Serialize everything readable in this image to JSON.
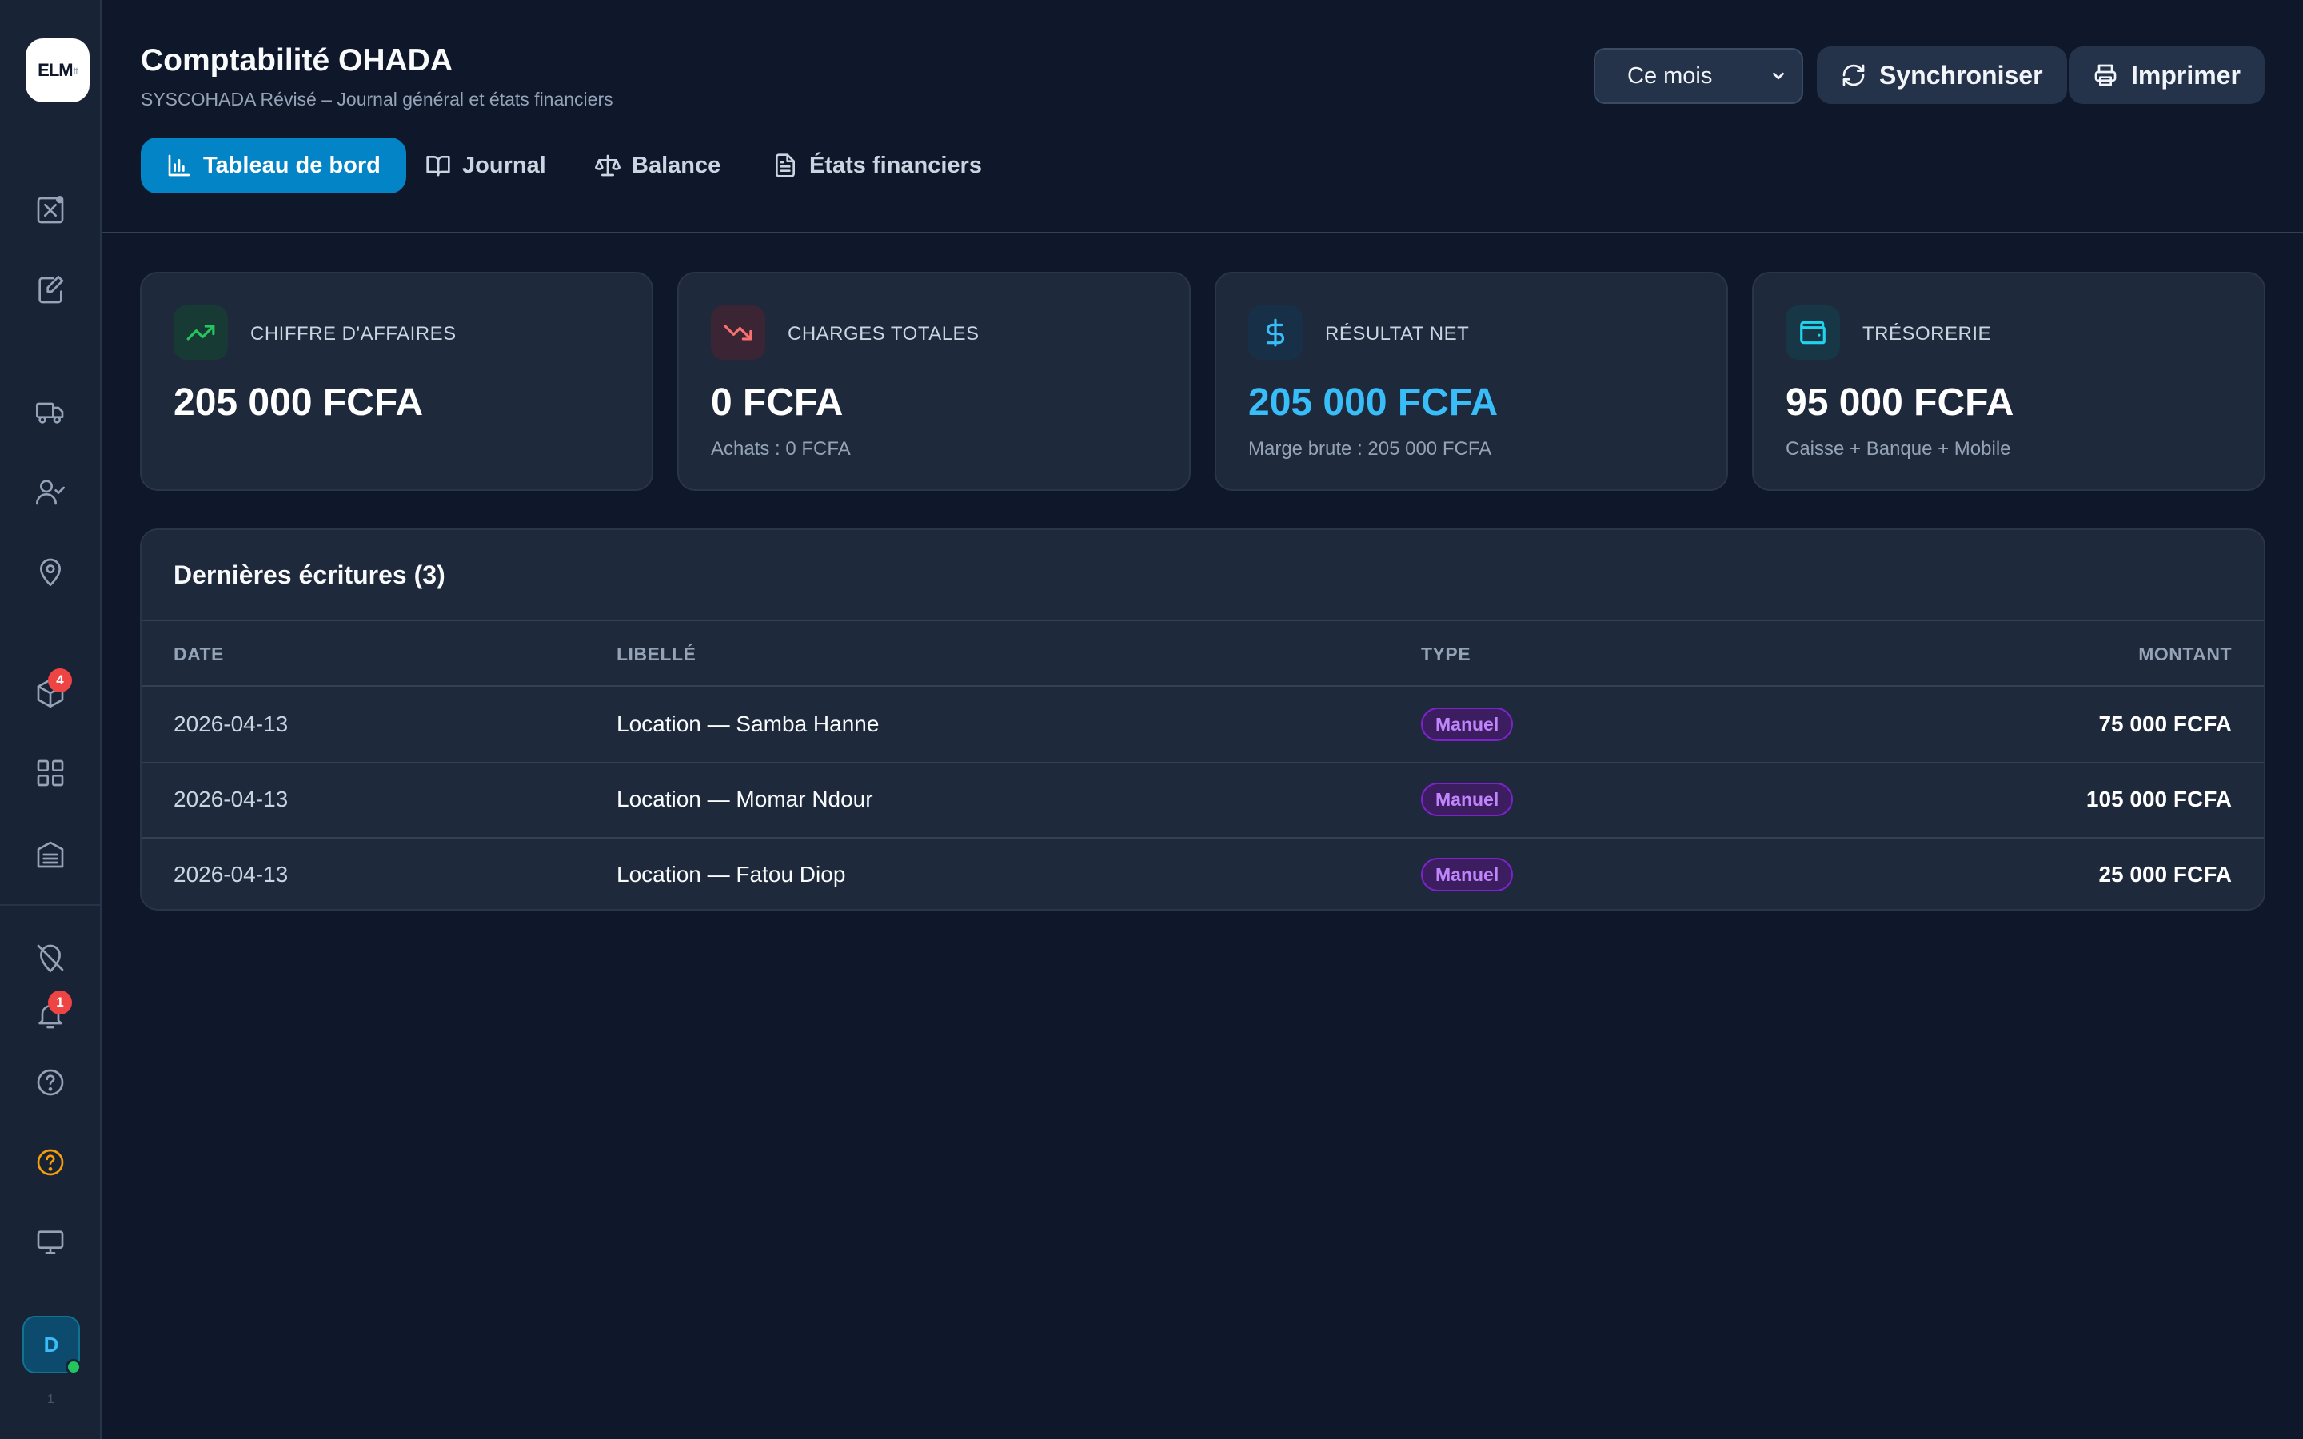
{
  "sidebar": {
    "logo_text": "ELM",
    "logo_sub": "tt",
    "items": [
      {
        "icon": "spreadsheet-x-icon"
      },
      {
        "icon": "edit-document-icon"
      },
      {
        "icon": "truck-icon"
      },
      {
        "icon": "user-check-icon"
      },
      {
        "icon": "map-pin-icon"
      },
      {
        "icon": "package-icon",
        "badge": "4"
      },
      {
        "icon": "grid-icon"
      },
      {
        "icon": "building-icon"
      },
      {
        "icon": "location-off-icon"
      },
      {
        "icon": "bell-icon",
        "badge": "1"
      },
      {
        "icon": "help-circle-icon"
      },
      {
        "icon": "help-circle-icon",
        "color": "#f59e0b"
      },
      {
        "icon": "monitor-icon"
      }
    ],
    "avatar_initial": "D",
    "bottom_count": "1"
  },
  "header": {
    "title": "Comptabilité OHADA",
    "subtitle": "SYSCOHADA Révisé – Journal général et états financiers",
    "period_select": "Ce mois",
    "sync_label": "Synchroniser",
    "print_label": "Imprimer"
  },
  "tabs": [
    {
      "label": "Tableau de bord",
      "icon": "bar-chart-icon",
      "active": true
    },
    {
      "label": "Journal",
      "icon": "book-open-icon"
    },
    {
      "label": "Balance",
      "icon": "scale-icon"
    },
    {
      "label": "États financiers",
      "icon": "file-text-icon"
    }
  ],
  "cards": [
    {
      "label": "CHIFFRE D'AFFAIRES",
      "value": "205 000 FCFA",
      "note": "",
      "icon": "trending-up-icon",
      "accent": "#22c55e"
    },
    {
      "label": "CHARGES TOTALES",
      "value": "0 FCFA",
      "note": "Achats : 0 FCFA",
      "icon": "trending-down-icon",
      "accent": "#f87171"
    },
    {
      "label": "RÉSULTAT NET",
      "value": "205 000 FCFA",
      "note": "Marge brute : 205 000 FCFA",
      "icon": "dollar-icon",
      "accent": "#38bdf8"
    },
    {
      "label": "TRÉSORERIE",
      "value": "95 000 FCFA",
      "note": "Caisse + Banque + Mobile",
      "icon": "wallet-icon",
      "accent": "#22d3ee"
    }
  ],
  "journal": {
    "title": "Dernières écritures (3)",
    "columns": [
      "DATE",
      "LIBELLÉ",
      "TYPE",
      "MONTANT"
    ],
    "rows": [
      {
        "date": "2026-04-13",
        "label": "Location — Samba Hanne",
        "type": "Manuel",
        "amount": "75 000 FCFA"
      },
      {
        "date": "2026-04-13",
        "label": "Location — Momar Ndour",
        "type": "Manuel",
        "amount": "105 000 FCFA"
      },
      {
        "date": "2026-04-13",
        "label": "Location — Fatou Diop",
        "type": "Manuel",
        "amount": "25 000 FCFA"
      }
    ]
  },
  "colors": {
    "background": "#0f172a",
    "card": "#1e293b",
    "primary": "#0284c7",
    "badge": "#ef4444",
    "pill": "#c084fc"
  }
}
